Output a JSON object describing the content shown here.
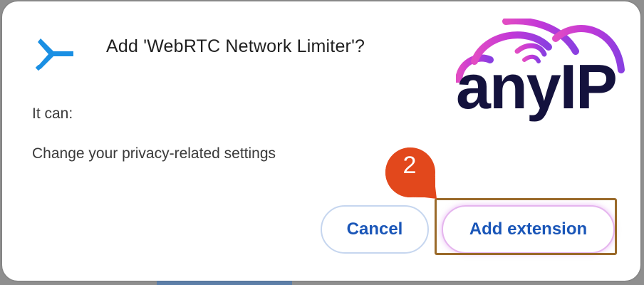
{
  "dialog": {
    "title": "Add 'WebRTC Network Limiter'?",
    "intro": "It can:",
    "permissions": [
      "Change your privacy-related settings"
    ],
    "buttons": {
      "cancel": "Cancel",
      "add": "Add extension"
    },
    "extension_icon": "webrtc-network-limiter-icon"
  },
  "overlay": {
    "step_badge": "2",
    "step_badge_color": "#e2481c",
    "highlight_color": "#9a6a2a"
  },
  "watermark": {
    "text": "anyIP",
    "text_color": "#14123d",
    "arc_colors": [
      "#c238d8",
      "#8a3fe0",
      "#e14cc3"
    ]
  },
  "colors": {
    "button_text": "#1a56b8",
    "button_border": "#c6d6ef",
    "icon_blue": "#1a8fe3"
  }
}
